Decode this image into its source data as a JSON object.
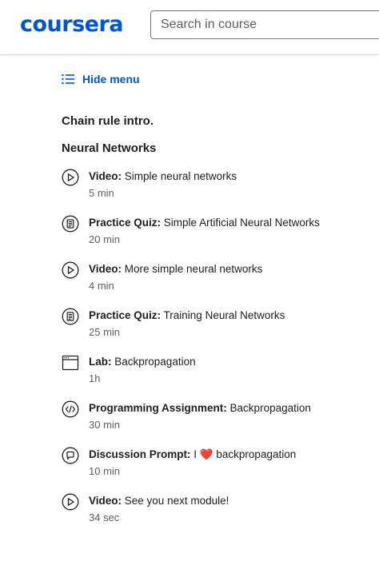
{
  "header": {
    "logo_text": "coursera",
    "search_placeholder": "Search in course",
    "brand_color": "#0056d2"
  },
  "nav": {
    "hide_menu_label": "Hide menu",
    "hide_menu_icon": "list-icon"
  },
  "sections": {
    "lesson_title": "Chain rule intro.",
    "module_title": "Neural Networks"
  },
  "items": [
    {
      "type": "Video:",
      "name": "Simple neural networks",
      "duration": "5 min",
      "icon": "play-icon"
    },
    {
      "type": "Practice Quiz:",
      "name": "Simple Artificial Neural Networks",
      "duration": "20 min",
      "icon": "quiz-icon"
    },
    {
      "type": "Video:",
      "name": "More simple neural networks",
      "duration": "4 min",
      "icon": "play-icon"
    },
    {
      "type": "Practice Quiz:",
      "name": "Training Neural Networks",
      "duration": "25 min",
      "icon": "quiz-icon"
    },
    {
      "type": "Lab:",
      "name": "Backpropagation",
      "duration": "1h",
      "icon": "lab-window-icon"
    },
    {
      "type": "Programming Assignment:",
      "name": "Backpropagation",
      "duration": "30 min",
      "icon": "code-icon"
    },
    {
      "type": "Discussion Prompt:",
      "name_prefix": "I",
      "name_emoji": "❤️",
      "name": "backpropagation",
      "duration": "10 min",
      "icon": "chat-bubble-icon"
    },
    {
      "type": "Video:",
      "name": "See you next module!",
      "duration": "34 sec",
      "icon": "play-icon"
    }
  ]
}
